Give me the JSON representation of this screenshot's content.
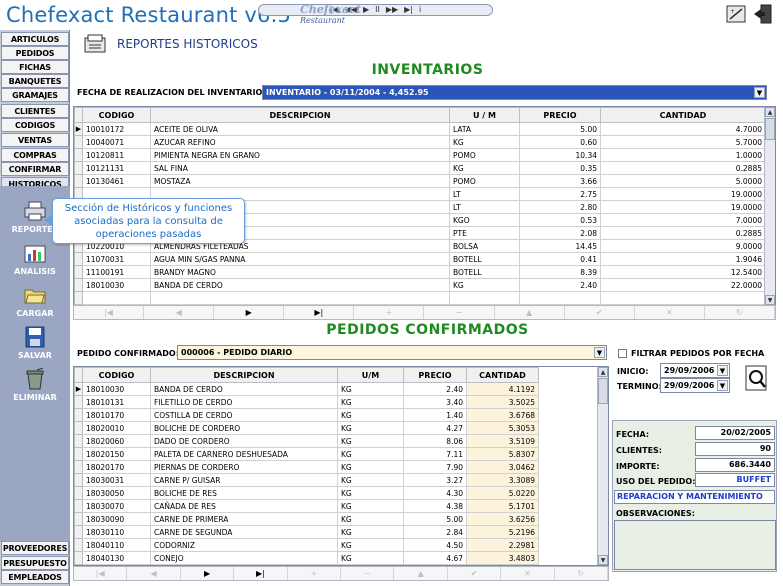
{
  "app": {
    "title": "Chefexact Restaurant v6.5",
    "logo_line1": "Chefexact",
    "logo_line2": "Restaurant"
  },
  "media_bar": {
    "controls": [
      "|◀",
      "◀◀",
      "▶",
      "II",
      "▶▶",
      "▶|",
      "i"
    ]
  },
  "sidebar": {
    "items": [
      {
        "label": "ARTICULOS"
      },
      {
        "label": "PEDIDOS"
      },
      {
        "label": "FICHAS"
      },
      {
        "label": "BANQUETES"
      },
      {
        "label": "GRAMAJES"
      },
      {
        "label": "CLIENTES"
      },
      {
        "label": "CODIGOS"
      },
      {
        "label": "VENTAS"
      },
      {
        "label": "COMPRAS"
      },
      {
        "label": "CONFIRMAR"
      },
      {
        "label": "HISTORICOS"
      }
    ],
    "tools": [
      {
        "label": "REPORTES",
        "icon": "printer-icon"
      },
      {
        "label": "ANALISIS",
        "icon": "chart-icon"
      },
      {
        "label": "CARGAR",
        "icon": "folder-icon"
      },
      {
        "label": "SALVAR",
        "icon": "floppy-icon"
      },
      {
        "label": "ELIMINAR",
        "icon": "trash-icon"
      }
    ],
    "bottom_items": [
      {
        "label": "PROVEEDORES"
      },
      {
        "label": "PRESUPUESTO"
      },
      {
        "label": "EMPLEADOS"
      }
    ]
  },
  "tooltip": {
    "text": "Sección de Históricos y funciones asociadas para la consulta de operaciones pasadas"
  },
  "header": {
    "title": "REPORTES HISTORICOS"
  },
  "inventarios": {
    "title": "INVENTARIOS",
    "date_label": "FECHA DE REALIZACION DEL INVENTARIO:",
    "date_value": "INVENTARIO - 03/11/2004 -        4,452.95",
    "columns": [
      "CODIGO",
      "DESCRIPCION",
      "U / M",
      "PRECIO",
      "CANTIDAD"
    ],
    "rows": [
      [
        "10010172",
        "ACEITE DE OLIVA",
        "LATA",
        "5.00",
        "4.7000"
      ],
      [
        "10040071",
        "AZUCAR REFINO",
        "KG",
        "0.60",
        "5.7000"
      ],
      [
        "10120811",
        "PIMIENTA NEGRA EN GRANO",
        "POMO",
        "10.34",
        "1.0000"
      ],
      [
        "10121131",
        "SAL FINA",
        "KG",
        "0.35",
        "0.2885"
      ],
      [
        "10130461",
        "MOSTAZA",
        "POMO",
        "3.66",
        "5.0000"
      ],
      [
        "",
        "",
        "LT",
        "2.75",
        "19.0000"
      ],
      [
        "",
        "",
        "LT",
        "2.80",
        "19.0000"
      ],
      [
        "",
        "",
        "KGO",
        "0.53",
        "7.0000"
      ],
      [
        "",
        "",
        "PTE",
        "2.08",
        "0.2885"
      ],
      [
        "10220010",
        "ALMENDRAS FILETEADAS",
        "BOLSA",
        "14.45",
        "9.0000"
      ],
      [
        "11070031",
        "AGUA MIN S/GAS PANNA",
        "BOTELL",
        "0.41",
        "1.9046"
      ],
      [
        "11100191",
        "BRANDY MAGNO",
        "BOTELL",
        "8.39",
        "12.5400"
      ],
      [
        "18010030",
        "BANDA DE CERDO",
        "KG",
        "2.40",
        "22.0000"
      ],
      [
        "",
        "",
        "",
        "",
        ""
      ]
    ]
  },
  "pedidos": {
    "title": "PEDIDOS CONFIRMADOS",
    "order_label": "PEDIDO CONFIRMADO:",
    "order_value": "000006 - PEDIDO DIARIO",
    "columns": [
      "CODIGO",
      "DESCRIPCION",
      "U/M",
      "PRECIO",
      "CANTIDAD"
    ],
    "rows": [
      [
        "18010030",
        "BANDA DE CERDO",
        "KG",
        "2.40",
        "4.1192"
      ],
      [
        "18010131",
        "FILETILLO DE CERDO",
        "KG",
        "3.40",
        "3.5025"
      ],
      [
        "18010170",
        "COSTILLA DE CERDO",
        "KG",
        "1.40",
        "3.6768"
      ],
      [
        "18020010",
        "BOLICHE DE CORDERO",
        "KG",
        "4.27",
        "5.3053"
      ],
      [
        "18020060",
        "DADO DE CORDERO",
        "KG",
        "8.06",
        "3.5109"
      ],
      [
        "18020150",
        "PALETA DE CARNERO DESHUESADA",
        "KG",
        "7.11",
        "5.8307"
      ],
      [
        "18020170",
        "PIERNAS DE CORDERO",
        "KG",
        "7.90",
        "3.0462"
      ],
      [
        "18030031",
        "CARNE P/ GUISAR",
        "KG",
        "3.27",
        "3.3089"
      ],
      [
        "18030050",
        "BOLICHE DE RES",
        "KG",
        "4.30",
        "5.0220"
      ],
      [
        "18030070",
        "CAÑADA DE RES",
        "KG",
        "4.38",
        "5.1701"
      ],
      [
        "18030090",
        "CARNE DE PRIMERA",
        "KG",
        "5.00",
        "3.6256"
      ],
      [
        "18030110",
        "CARNE DE SEGUNDA",
        "KG",
        "2.84",
        "5.2196"
      ],
      [
        "18040110",
        "CODORNIZ",
        "KG",
        "4.50",
        "2.2981"
      ],
      [
        "18040130",
        "CONEJO",
        "KG",
        "4.67",
        "3.4803"
      ],
      [
        "18040410",
        "PATO",
        "KG",
        "8.00",
        "4.9558"
      ]
    ]
  },
  "filter": {
    "checkbox_label": "FILTRAR PEDIDOS POR FECHA",
    "start_label": "INICIO:",
    "start_value": "29/09/2006",
    "end_label": "TERMINO:",
    "end_value": "29/09/2006"
  },
  "details": {
    "fecha_label": "FECHA:",
    "fecha_value": "20/02/2005",
    "clientes_label": "CLIENTES:",
    "clientes_value": "90",
    "importe_label": "IMPORTE:",
    "importe_value": "686.3440",
    "uso_label": "USO DEL PEDIDO:",
    "uso_value": "BUFFET",
    "motivo_value": "REPARACION Y MANTENIMIENTO",
    "observaciones_label": "OBSERVACIONES:"
  },
  "navbar": {
    "buttons": [
      "|◀",
      "◀",
      "▶",
      "▶|",
      "+",
      "−",
      "▲",
      "✔",
      "✕",
      "↻"
    ]
  },
  "colors": {
    "accent": "#1f6fb8",
    "section_title": "#1f8a1f",
    "sidebar": "#9aa6c2",
    "field_highlight": "#1c3ec8"
  }
}
